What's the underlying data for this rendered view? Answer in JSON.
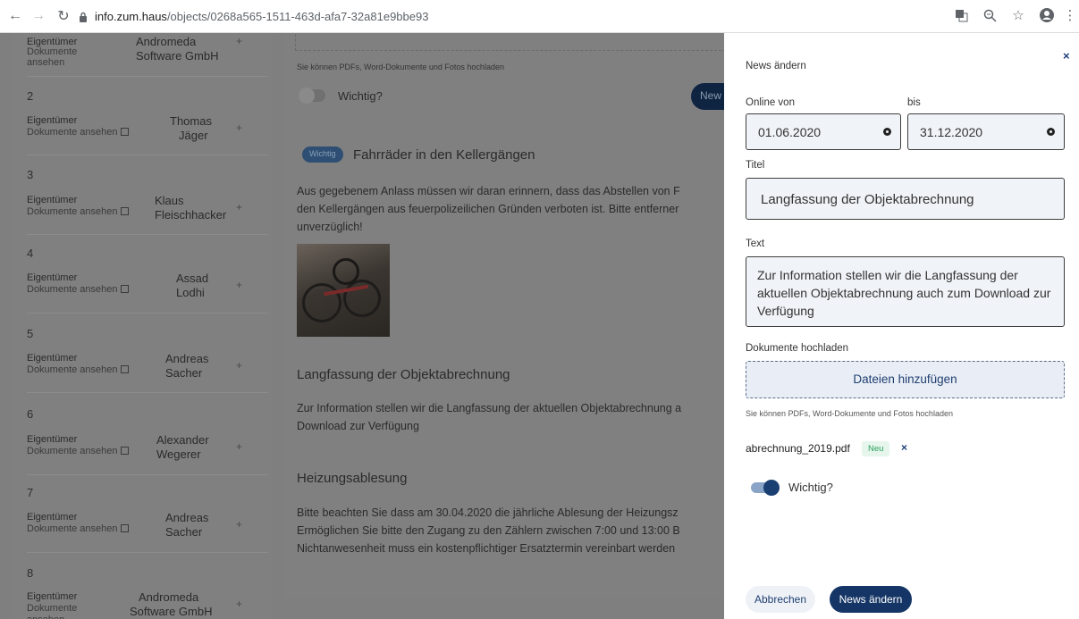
{
  "browser": {
    "url_host": "info.zum.haus",
    "url_path": "/objects/0268a565-1511-463d-afa7-32a81e9bbe93"
  },
  "objects": [
    {
      "num": "",
      "role": "Eigentümer",
      "docs": "Dokumente ansehen",
      "owner": "Andromeda Software GmbH"
    },
    {
      "num": "2",
      "role": "Eigentümer",
      "docs": "Dokumente ansehen",
      "owner_line1": "Thomas",
      "owner_line2": "Jäger"
    },
    {
      "num": "3",
      "role": "Eigentümer",
      "docs": "Dokumente ansehen",
      "owner_line1": "Klaus",
      "owner_line2": "Fleischhacker"
    },
    {
      "num": "4",
      "role": "Eigentümer",
      "docs": "Dokumente ansehen",
      "owner_line1": "Assad",
      "owner_line2": "Lodhi"
    },
    {
      "num": "5",
      "role": "Eigentümer",
      "docs": "Dokumente ansehen",
      "owner_line1": "Andreas",
      "owner_line2": "Sacher"
    },
    {
      "num": "6",
      "role": "Eigentümer",
      "docs": "Dokumente ansehen",
      "owner_line1": "Alexander",
      "owner_line2": "Wegerer"
    },
    {
      "num": "7",
      "role": "Eigentümer",
      "docs": "Dokumente ansehen",
      "owner_line1": "Andreas",
      "owner_line2": "Sacher"
    },
    {
      "num": "8",
      "role": "Eigentümer",
      "docs": "Dokumente",
      "docs2": "ansehen",
      "owner_line1": "Andromeda",
      "owner_line2": "Software GmbH"
    }
  ],
  "plus": "+",
  "middle": {
    "upload_hint": "Sie können PDFs, Word-Dokumente und Fotos hochladen",
    "wichtig_label": "Wichtig?",
    "new_button": "New",
    "badge": "Wichtig",
    "news1_title": "Fahrräder in den Kellergängen",
    "news1_text_1": "Aus gegebenem Anlass müssen wir daran erinnern, dass das Abstellen von F",
    "news1_text_2": "den Kellergängen aus feuerpolizeilichen Gründen verboten ist. Bitte entferner",
    "news1_text_3": "unverzüglich!",
    "news2_title": "Langfassung der Objektabrechnung",
    "news2_text_1": "Zur Information stellen wir die Langfassung der aktuellen Objektabrechnung a",
    "news2_text_2": "Download zur Verfügung",
    "news3_title": "Heizungsablesung",
    "news3_text_1": "Bitte beachten Sie dass am 30.04.2020 die jährliche Ablesung der Heizungsz",
    "news3_text_2": "Ermöglichen Sie bitte den Zugang zu den Zählern zwischen 7:00 und 13:00 B",
    "news3_text_3": "Nichtanwesenheit muss ein kostenpflichtiger Ersatztermin vereinbart werden"
  },
  "panel": {
    "title": "News ändern",
    "close": "×",
    "online_von_label": "Online von",
    "bis_label": "bis",
    "date_from": "01.06.2020",
    "date_to": "31.12.2020",
    "titel_label": "Titel",
    "titel_value": "Langfassung der Objektabrechnung",
    "text_label": "Text",
    "text_value": "Zur Information stellen wir die Langfassung der aktuellen Objektabrechnung auch zum Download zur Verfügung",
    "upload_label": "Dokumente hochladen",
    "upload_button": "Dateien hinzufügen",
    "upload_hint": "Sie können PDFs, Word-Dokumente und Fotos hochladen",
    "file_name": "abrechnung_2019.pdf",
    "file_badge": "Neu",
    "file_remove": "×",
    "wichtig_label": "Wichtig?",
    "wichtig_on": true,
    "cancel_button": "Abbrechen",
    "save_button": "News ändern"
  },
  "colors": {
    "primary": "#143565",
    "overlay": "#808080",
    "field_bg": "#f0f3f7"
  }
}
